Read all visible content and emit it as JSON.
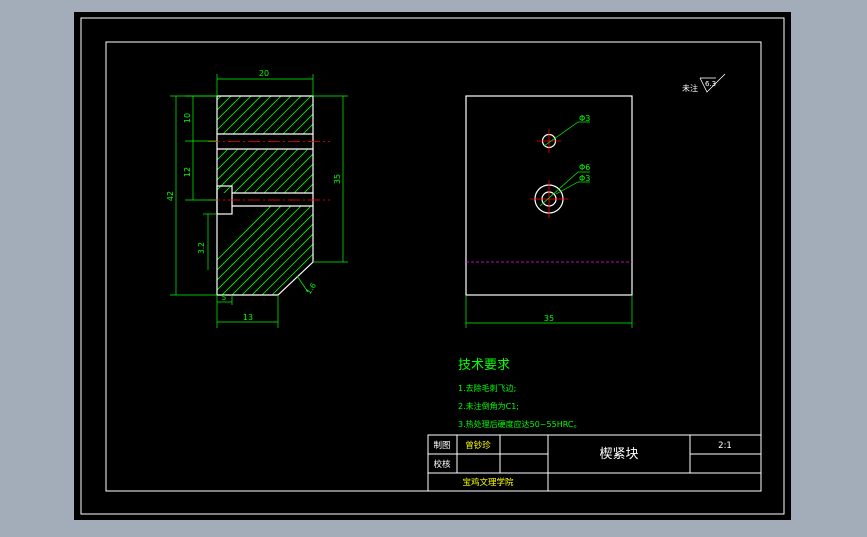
{
  "drawing": {
    "colors": {
      "background": "#a3acb9",
      "paper": "#000000",
      "frame": "#ffffff",
      "geometry": "#ffffff",
      "dimension": "#00ff00",
      "hatch": "#00ff00",
      "centerline": "#ff0000",
      "hidden_line": "#ff00ff",
      "text": "#ffffff"
    },
    "section_view": {
      "dim_width_top": "20",
      "dim_10": "10",
      "dim_12": "12",
      "dim_42": "42",
      "dim_35": "35",
      "dim_32": "3.2",
      "dim_5": "5",
      "dim_13": "13",
      "dim_16": "1.6"
    },
    "front_view": {
      "hole_small_label": "Φ3",
      "hole_big_inner_label": "Φ6",
      "hole_big_outer_label": "Φ3",
      "width_label": "35"
    },
    "surface_note": {
      "prefix": "未注",
      "value": "6.3"
    },
    "tech_requirements": {
      "title": "技术要求",
      "items": [
        "1.去除毛刺飞边;",
        "2.未注倒角为C1;",
        "3.热处理后硬度应达50~55HRC。"
      ]
    },
    "title_block": {
      "label_drawn": "制图",
      "drawn_by": "曾钞珍",
      "label_checked": "校核",
      "part_name": "楔紧块",
      "scale": "2:1",
      "school": "宝鸡文理学院"
    }
  }
}
